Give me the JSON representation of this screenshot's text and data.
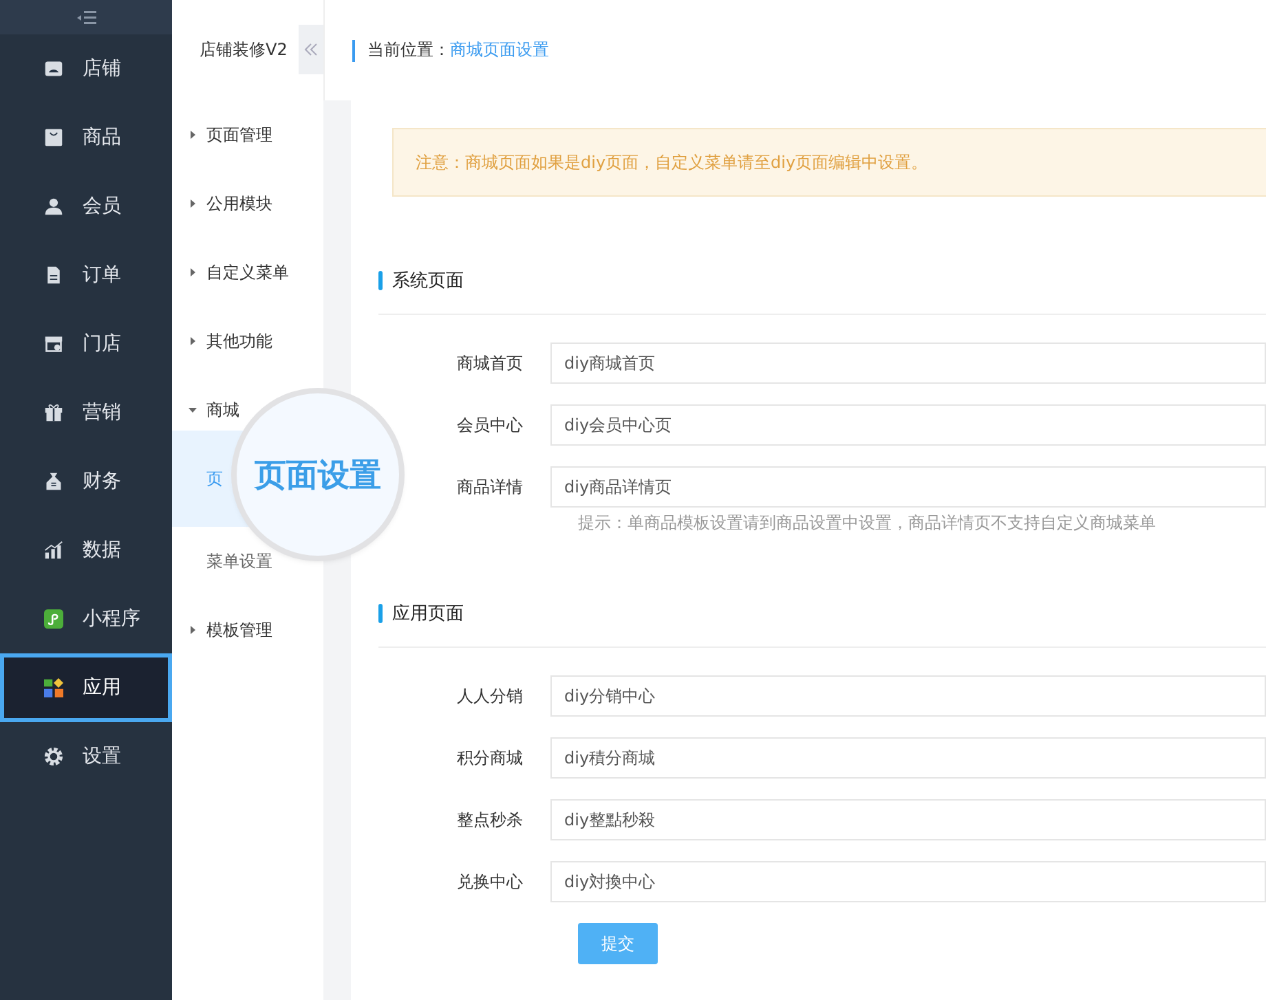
{
  "sidebar": {
    "items": [
      {
        "label": "店铺",
        "selected": false
      },
      {
        "label": "商品",
        "selected": false
      },
      {
        "label": "会员",
        "selected": false
      },
      {
        "label": "订单",
        "selected": false
      },
      {
        "label": "门店",
        "selected": false
      },
      {
        "label": "营销",
        "selected": false
      },
      {
        "label": "财务",
        "selected": false
      },
      {
        "label": "数据",
        "selected": false
      },
      {
        "label": "小程序",
        "selected": false
      },
      {
        "label": "应用",
        "selected": true
      },
      {
        "label": "设置",
        "selected": false
      }
    ]
  },
  "submenu": {
    "title": "店铺装修V2",
    "items": [
      {
        "label": "页面管理",
        "expanded": false
      },
      {
        "label": "公用模块",
        "expanded": false
      },
      {
        "label": "自定义菜单",
        "expanded": false
      },
      {
        "label": "其他功能",
        "expanded": false
      },
      {
        "label": "商城",
        "expanded": true,
        "children": [
          {
            "label": "页",
            "selected": true
          },
          {
            "label": "菜单设置",
            "selected": false
          }
        ]
      },
      {
        "label": "模板管理",
        "expanded": false
      }
    ]
  },
  "magnifier": {
    "text": "页面设置"
  },
  "breadcrumb": {
    "label": "当前位置：",
    "current": "商城页面设置"
  },
  "notice": "注意：商城页面如果是diy页面，自定义菜单请至diy页面编辑中设置。",
  "sections": [
    {
      "title": "系统页面",
      "fields": [
        {
          "label": "商城首页",
          "value": "diy商城首页"
        },
        {
          "label": "会员中心",
          "value": "diy会员中心页"
        },
        {
          "label": "商品详情",
          "value": "diy商品详情页"
        }
      ],
      "hint": "提示：单商品模板设置请到商品设置中设置，商品详情页不支持自定义商城菜单"
    },
    {
      "title": "应用页面",
      "fields": [
        {
          "label": "人人分销",
          "value": "diy分销中心"
        },
        {
          "label": "积分商城",
          "value": "diy積分商城"
        },
        {
          "label": "整点秒杀",
          "value": "diy整點秒殺"
        },
        {
          "label": "兑换中心",
          "value": "diy対換中心"
        }
      ]
    }
  ],
  "submit": "提交"
}
